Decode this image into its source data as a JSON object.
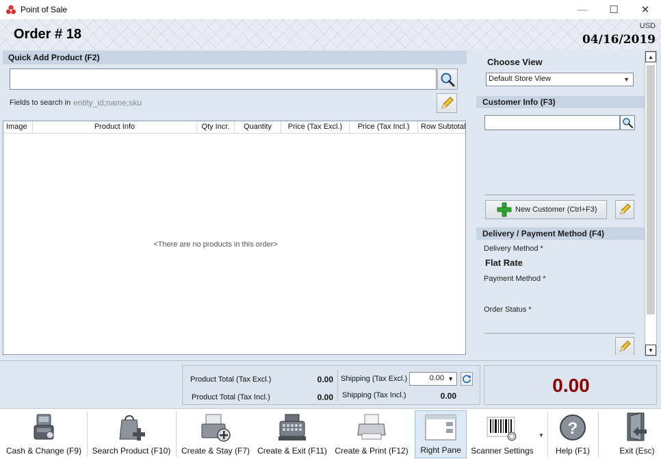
{
  "window": {
    "title": "Point of Sale",
    "controls": {
      "minimize": "—",
      "maximize": "☐",
      "close": "✕"
    }
  },
  "header": {
    "order_title": "Order # 18",
    "currency": "USD",
    "date": "04/16/2019"
  },
  "quick_add": {
    "heading": "Quick Add Product (F2)",
    "search_value": "",
    "fields_label": "Fields to search in",
    "fields_value": "entity_id;name;sku"
  },
  "grid": {
    "columns": [
      "Image",
      "Product Info",
      "Qty Incr.",
      "Quantity",
      "Price (Tax Excl.)",
      "Price (Tax Incl.)",
      "Row Subtotal"
    ],
    "empty_message": "<There are no products in this order>"
  },
  "right_pane": {
    "choose_view_label": "Choose View",
    "view_selected": "Default Store View",
    "customer_heading": "Customer Info (F3)",
    "customer_value": "",
    "new_customer_label": "New Customer (Ctrl+F3)",
    "delivery_heading": "Delivery / Payment Method (F4)",
    "delivery_method_label": "Delivery Method *",
    "delivery_method_value": "Flat Rate",
    "payment_method_label": "Payment Method *",
    "order_status_label": "Order Status *"
  },
  "totals": {
    "product_total_excl_label": "Product Total (Tax Excl.)",
    "product_total_excl_value": "0.00",
    "product_total_incl_label": "Product Total (Tax Incl.)",
    "product_total_incl_value": "0.00",
    "shipping_excl_label": "Shipping (Tax Excl.)",
    "shipping_excl_value": "0.00",
    "shipping_incl_label": "Shipping (Tax Incl.)",
    "shipping_incl_value": "0.00",
    "grand_total": "0.00"
  },
  "toolbar": {
    "cash_change": "Cash & Change (F9)",
    "search_product": "Search Product (F10)",
    "create_stay": "Create & Stay (F7)",
    "create_exit": "Create & Exit (F11)",
    "create_print": "Create & Print (F12)",
    "right_pane": "Right Pane",
    "scanner_settings": "Scanner Settings",
    "help": "Help (F1)",
    "exit": "Exit (Esc)"
  },
  "colors": {
    "panel_bg": "#dfe7f1",
    "section_head": "#c6d4e4",
    "grand_total": "#8b0000",
    "active_button": "#dde9f7"
  }
}
